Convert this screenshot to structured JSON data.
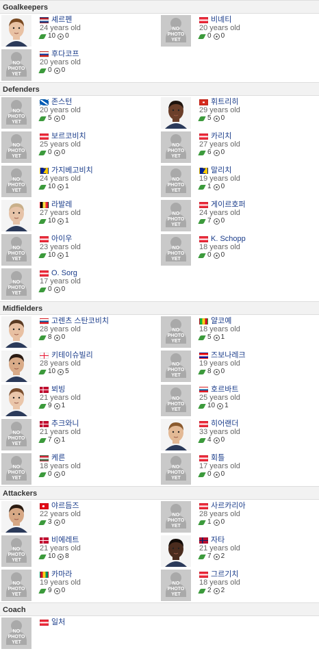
{
  "sections": [
    {
      "title": "Goalkeepers",
      "players": [
        {
          "name": "셰르펜",
          "age": "24 years old",
          "apps": "10",
          "goals": "0",
          "flag": "nl",
          "photo": "face",
          "skin": "#e9c2a4",
          "hair": "#7a4a22"
        },
        {
          "name": "비녜티",
          "age": "20 years old",
          "apps": "0",
          "goals": "0",
          "flag": "at",
          "photo": "none"
        },
        {
          "name": "후다코프",
          "age": "20 years old",
          "apps": "0",
          "goals": "0",
          "flag": "ru",
          "photo": "none"
        }
      ]
    },
    {
      "title": "Defenders",
      "players": [
        {
          "name": "존스턴",
          "age": "20 years old",
          "apps": "5",
          "goals": "0",
          "flag": "sco",
          "photo": "none"
        },
        {
          "name": "휘트리히",
          "age": "29 years old",
          "apps": "5",
          "goals": "0",
          "flag": "ch",
          "photo": "face",
          "skin": "#6b3f2a",
          "hair": "#1f140e"
        },
        {
          "name": "보르코비치",
          "age": "25 years old",
          "apps": "0",
          "goals": "0",
          "flag": "at",
          "photo": "none"
        },
        {
          "name": "카리치",
          "age": "27 years old",
          "apps": "6",
          "goals": "0",
          "flag": "at",
          "photo": "none"
        },
        {
          "name": "가지베고비치",
          "age": "24 years old",
          "apps": "10",
          "goals": "1",
          "flag": "ba",
          "photo": "none"
        },
        {
          "name": "말리치",
          "age": "19 years old",
          "apps": "1",
          "goals": "0",
          "flag": "ba",
          "photo": "none"
        },
        {
          "name": "라발레",
          "age": "27 years old",
          "apps": "10",
          "goals": "1",
          "flag": "be",
          "photo": "face",
          "skin": "#e6c3a8",
          "hair": "#c9b08a"
        },
        {
          "name": "게이르호퍼",
          "age": "24 years old",
          "apps": "7",
          "goals": "0",
          "flag": "at",
          "photo": "none"
        },
        {
          "name": "아이우",
          "age": "23 years old",
          "apps": "10",
          "goals": "1",
          "flag": "at",
          "photo": "none"
        },
        {
          "name": "K. Schopp",
          "age": "18 years old",
          "apps": "0",
          "goals": "0",
          "flag": "at",
          "photo": "none"
        },
        {
          "name": "O. Sorg",
          "age": "17 years old",
          "apps": "0",
          "goals": "0",
          "flag": "at",
          "photo": "none"
        }
      ]
    },
    {
      "title": "Midfielders",
      "players": [
        {
          "name": "고렌츠 스탄코비치",
          "age": "28 years old",
          "apps": "8",
          "goals": "0",
          "flag": "si",
          "photo": "face",
          "skin": "#e8c0a2",
          "hair": "#5a3a22"
        },
        {
          "name": "얄코예",
          "age": "18 years old",
          "apps": "5",
          "goals": "1",
          "flag": "ml",
          "photo": "none"
        },
        {
          "name": "키테이슈빌리",
          "age": "28 years old",
          "apps": "10",
          "goals": "5",
          "flag": "ge",
          "photo": "face",
          "skin": "#d9ab88",
          "hair": "#2a1a12"
        },
        {
          "name": "즈보나레크",
          "age": "19 years old",
          "apps": "8",
          "goals": "0",
          "flag": "hr",
          "photo": "none"
        },
        {
          "name": "뵈빙",
          "age": "21 years old",
          "apps": "9",
          "goals": "1",
          "flag": "dk",
          "photo": "face",
          "skin": "#eac6aa",
          "hair": "#7a4e2e"
        },
        {
          "name": "호르바트",
          "age": "25 years old",
          "apps": "10",
          "goals": "1",
          "flag": "si",
          "photo": "none"
        },
        {
          "name": "추크와니",
          "age": "21 years old",
          "apps": "7",
          "goals": "1",
          "flag": "dk",
          "photo": "none"
        },
        {
          "name": "히어랜더",
          "age": "33 years old",
          "apps": "4",
          "goals": "0",
          "flag": "at",
          "photo": "face",
          "skin": "#e3b995",
          "hair": "#8a5a2e"
        },
        {
          "name": "케른",
          "age": "18 years old",
          "apps": "0",
          "goals": "0",
          "flag": "hu",
          "photo": "none"
        },
        {
          "name": "회틀",
          "age": "17 years old",
          "apps": "0",
          "goals": "0",
          "flag": "at",
          "photo": "none"
        }
      ]
    },
    {
      "title": "Attackers",
      "players": [
        {
          "name": "야르듬즈",
          "age": "22 years old",
          "apps": "3",
          "goals": "0",
          "flag": "tr",
          "photo": "face",
          "skin": "#d7a885",
          "hair": "#2a1a10"
        },
        {
          "name": "사르카리아",
          "age": "28 years old",
          "apps": "1",
          "goals": "0",
          "flag": "at",
          "photo": "none"
        },
        {
          "name": "비에레트",
          "age": "21 years old",
          "apps": "10",
          "goals": "8",
          "flag": "dk",
          "photo": "none"
        },
        {
          "name": "자타",
          "age": "21 years old",
          "apps": "7",
          "goals": "2",
          "flag": "no",
          "photo": "face",
          "skin": "#4a2c1e",
          "hair": "#120c08"
        },
        {
          "name": "카마라",
          "age": "19 years old",
          "apps": "9",
          "goals": "0",
          "flag": "gn",
          "photo": "none"
        },
        {
          "name": "그르기치",
          "age": "18 years old",
          "apps": "2",
          "goals": "2",
          "flag": "at",
          "photo": "none"
        }
      ]
    },
    {
      "title": "Coach",
      "players": [
        {
          "name": "일처",
          "flag": "at",
          "photo": "none"
        }
      ]
    }
  ],
  "no_photo_text": "NO PHOTO YET",
  "colors": {
    "name_link": "#1a3c8a",
    "boot": "#3c9a3c",
    "header_bg": "#f2f2f2"
  }
}
